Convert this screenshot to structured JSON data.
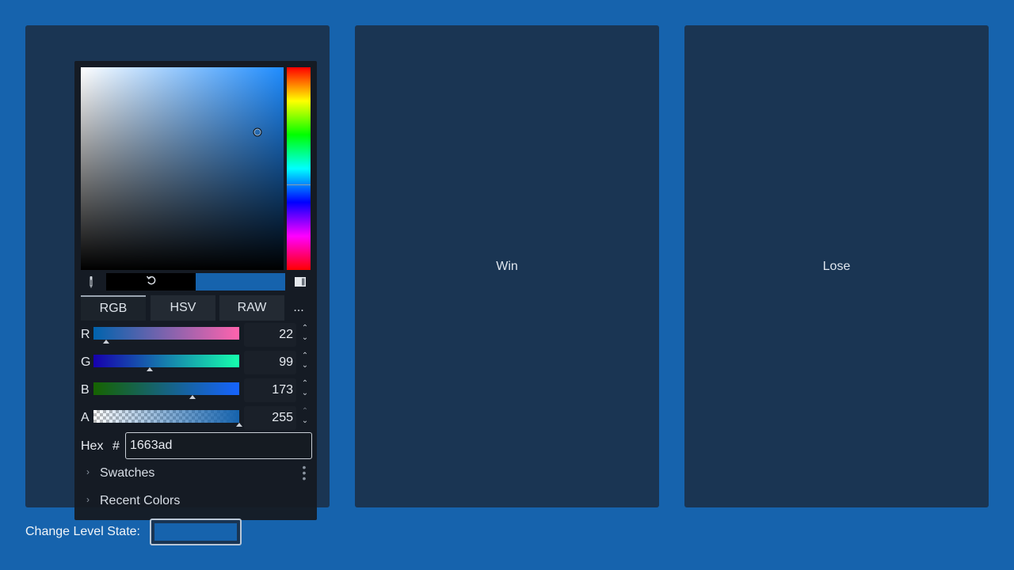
{
  "panels": {
    "left_label": "",
    "win_label": "Win",
    "lose_label": "Lose"
  },
  "color_picker": {
    "current_hex": "1663ad",
    "current_color": "#1663ad",
    "old_color": "#000000",
    "hue_fraction": 0.58,
    "saturation": 0.87,
    "value": 0.68,
    "tabs": [
      {
        "label": "RGB",
        "active": true
      },
      {
        "label": "HSV",
        "active": false
      },
      {
        "label": "RAW",
        "active": false
      }
    ],
    "more_label": "...",
    "channels": [
      {
        "label": "R",
        "value": "22",
        "level": 0.086,
        "gradient": "linear-gradient(to right, #0063ad, #ff63ad)"
      },
      {
        "label": "G",
        "value": "99",
        "level": 0.388,
        "gradient": "linear-gradient(to right, #1600ad, #16ffad)"
      },
      {
        "label": "B",
        "value": "173",
        "level": 0.678,
        "gradient": "linear-gradient(to right, #166300, #1663ff)"
      },
      {
        "label": "A",
        "value": "255",
        "level": 1.0,
        "gradient": "checker"
      }
    ],
    "hex_label": "Hex",
    "hex_prefix": "#",
    "sections": [
      {
        "title": "Swatches",
        "has_menu": true
      },
      {
        "title": "Recent Colors",
        "has_menu": false
      }
    ],
    "icons": {
      "eyedropper": "eyedropper-icon",
      "reset": "reset-icon",
      "shape": "picker-shape-icon"
    }
  },
  "level_state": {
    "label": "Change Level State:",
    "color": "#1663ad"
  }
}
